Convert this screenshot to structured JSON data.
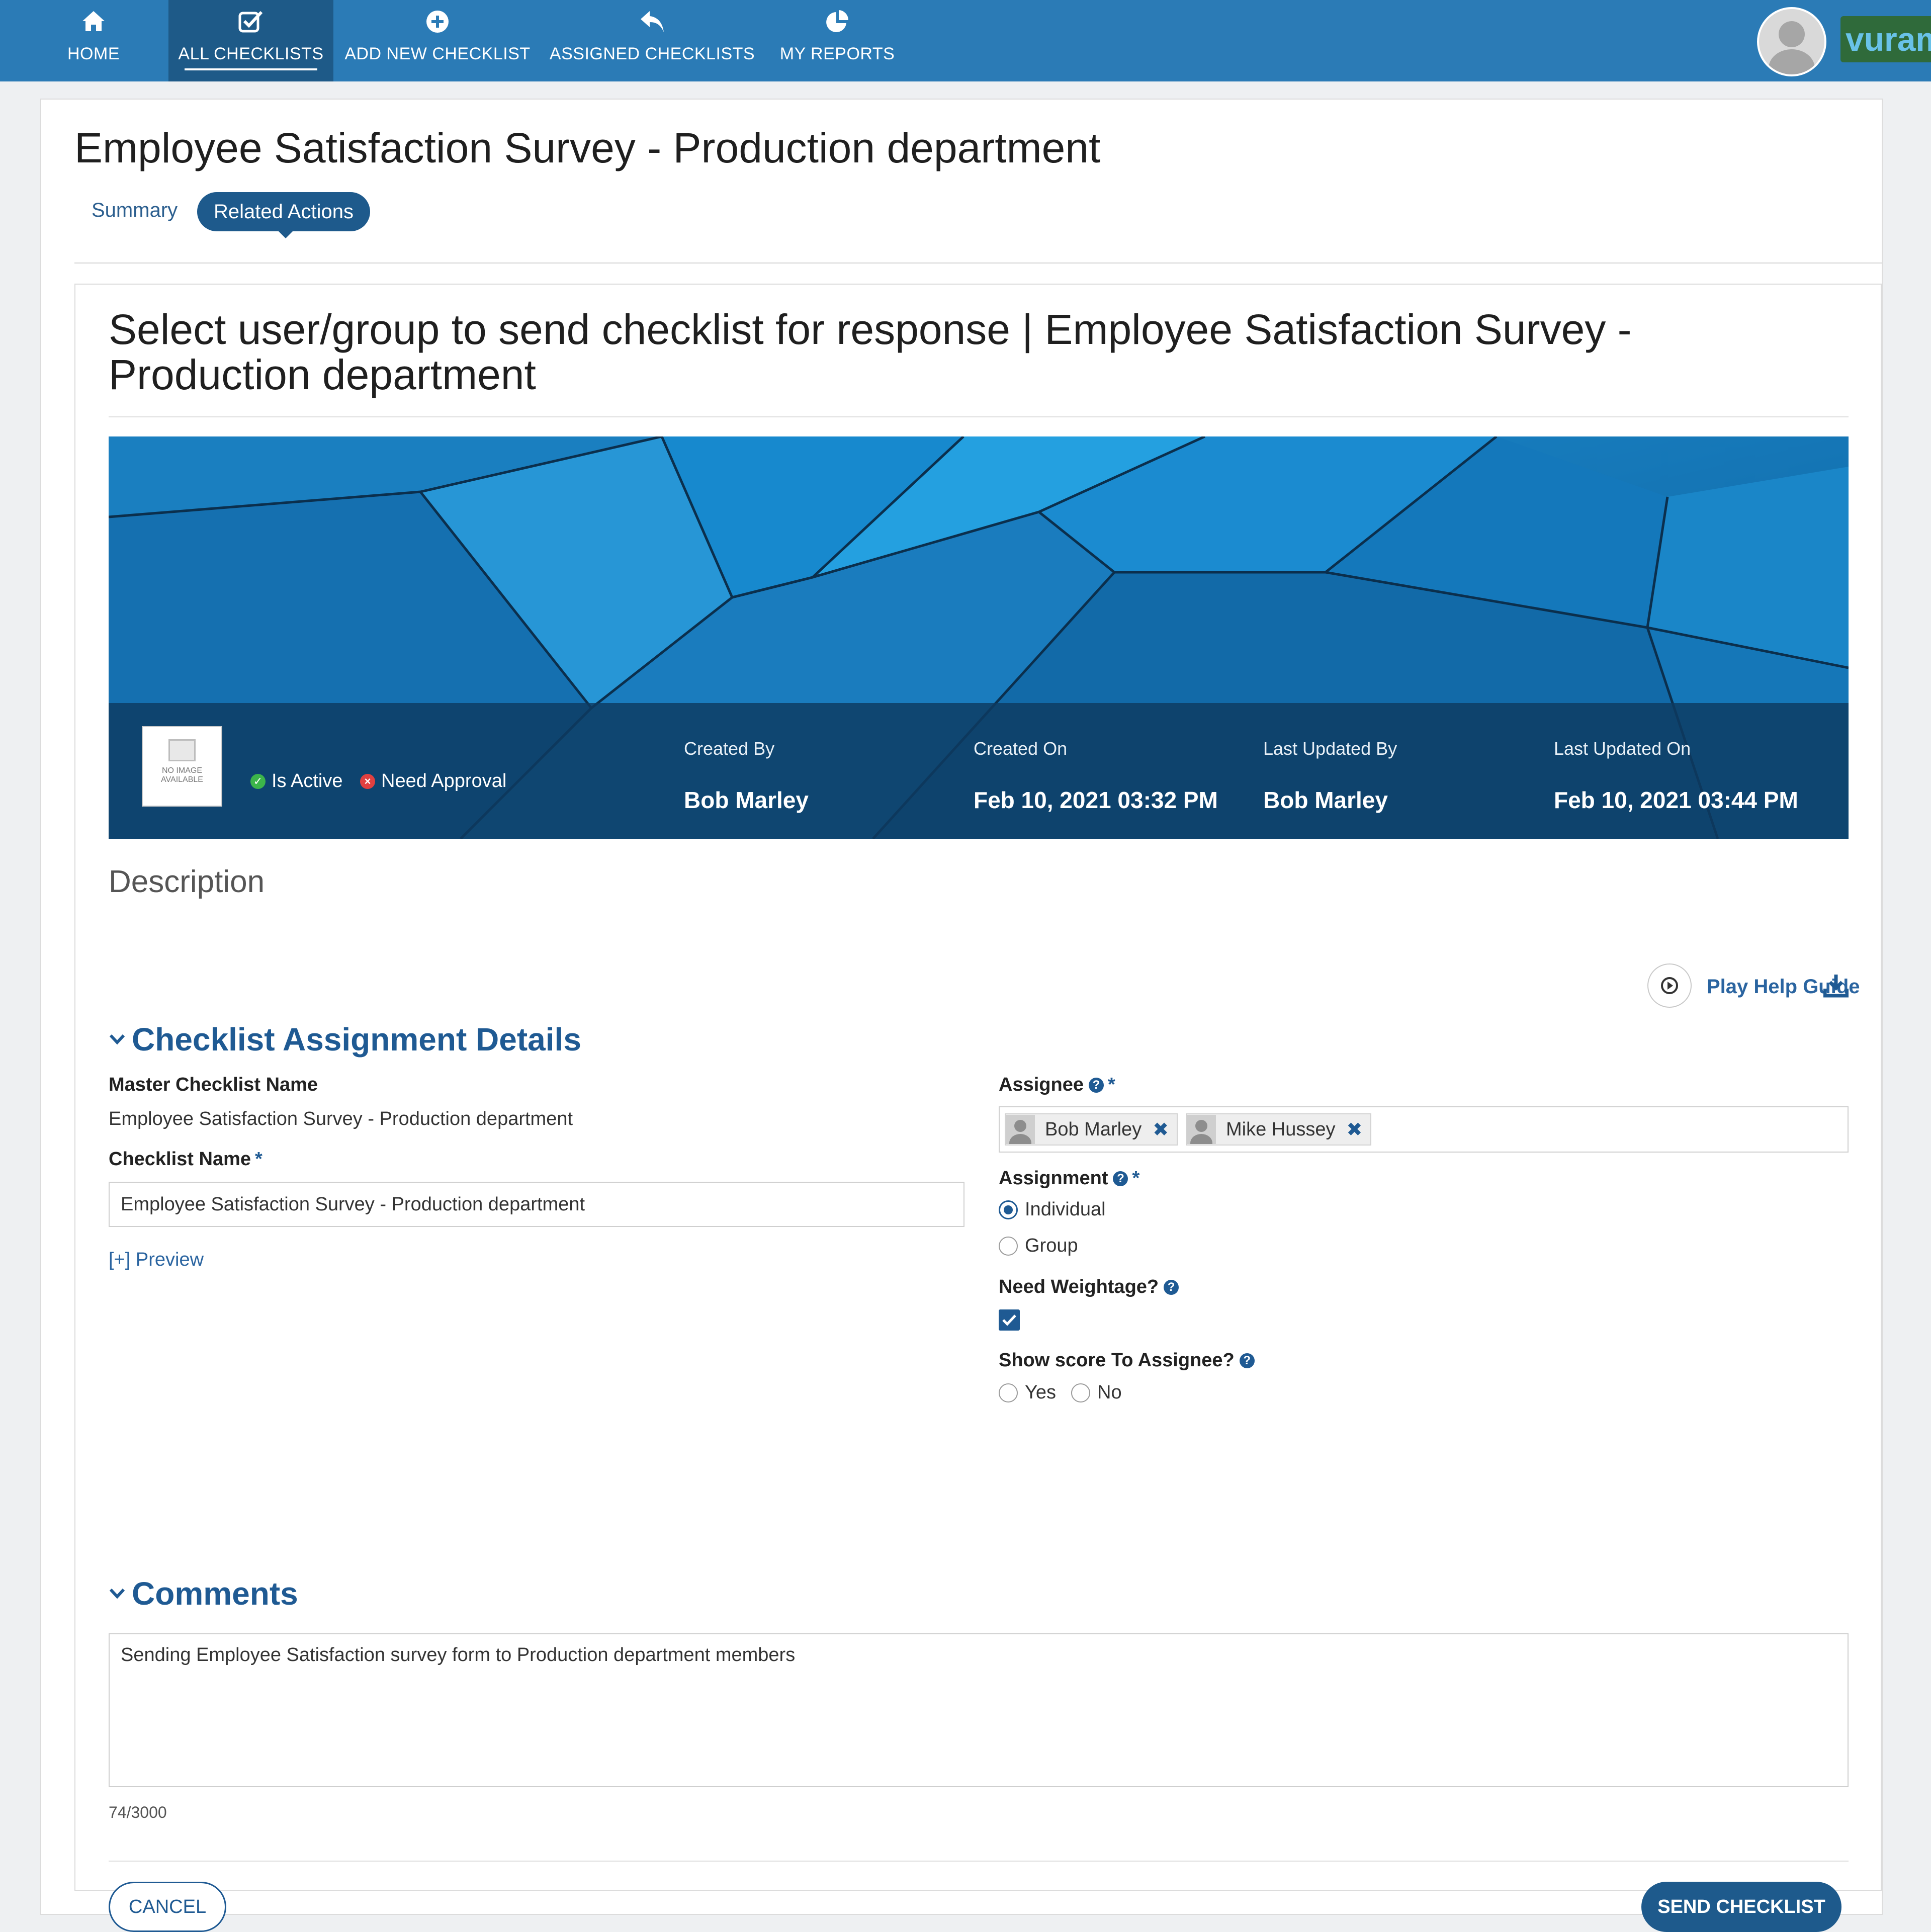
{
  "nav": {
    "items": [
      {
        "label": "HOME",
        "icon": "home-icon"
      },
      {
        "label": "ALL CHECKLISTS",
        "icon": "checklist-icon",
        "active": true
      },
      {
        "label": "ADD NEW CHECKLIST",
        "icon": "plus-circle-icon"
      },
      {
        "label": "ASSIGNED CHECKLISTS",
        "icon": "reply-icon"
      },
      {
        "label": "MY REPORTS",
        "icon": "pie-chart-icon"
      }
    ],
    "logo_text": "vuram"
  },
  "page": {
    "title": "Employee Satisfaction Survey - Production department",
    "tabs": [
      "Summary",
      "Related Actions"
    ],
    "active_tab": "Related Actions"
  },
  "panel": {
    "title": "Select user/group to send checklist for response | Employee Satisfaction Survey - Production department",
    "banner": {
      "no_image_text": "NO IMAGE AVAILABLE",
      "is_active_label": "Is Active",
      "need_approval_label": "Need Approval",
      "created_by_label": "Created By",
      "created_by": "Bob Marley",
      "created_on_label": "Created On",
      "created_on": "Feb 10, 2021 03:32 PM",
      "last_updated_by_label": "Last Updated By",
      "last_updated_by": "Bob Marley",
      "last_updated_on_label": "Last Updated On",
      "last_updated_on": "Feb 10, 2021 03:44 PM"
    },
    "description_label": "Description",
    "help_guide_label": "Play Help Guide"
  },
  "assignment": {
    "section_title": "Checklist Assignment Details",
    "master_name_label": "Master Checklist Name",
    "master_name_value": "Employee Satisfaction Survey - Production department",
    "checklist_name_label": "Checklist Name",
    "checklist_name_value": "Employee Satisfaction Survey - Production department",
    "preview_link": "[+] Preview",
    "assignee_label": "Assignee",
    "assignees": [
      "Bob Marley",
      "Mike Hussey"
    ],
    "assignment_label": "Assignment",
    "assignment_options": [
      "Individual",
      "Group"
    ],
    "assignment_selected": "Individual",
    "weightage_label": "Need Weightage?",
    "weightage_checked": true,
    "show_score_label": "Show score To Assignee?",
    "show_score_options": [
      "Yes",
      "No"
    ],
    "required_mark": "*"
  },
  "comments": {
    "section_title": "Comments",
    "text": "Sending Employee Satisfaction survey form to Production department members",
    "counter": "74/3000"
  },
  "actions": {
    "cancel_label": "CANCEL",
    "send_label": "SEND CHECKLIST"
  },
  "colors": {
    "nav_bg": "#2b7bb6",
    "nav_active": "#1e5a88",
    "accent": "#1f5a93",
    "link": "#2a64a0"
  }
}
